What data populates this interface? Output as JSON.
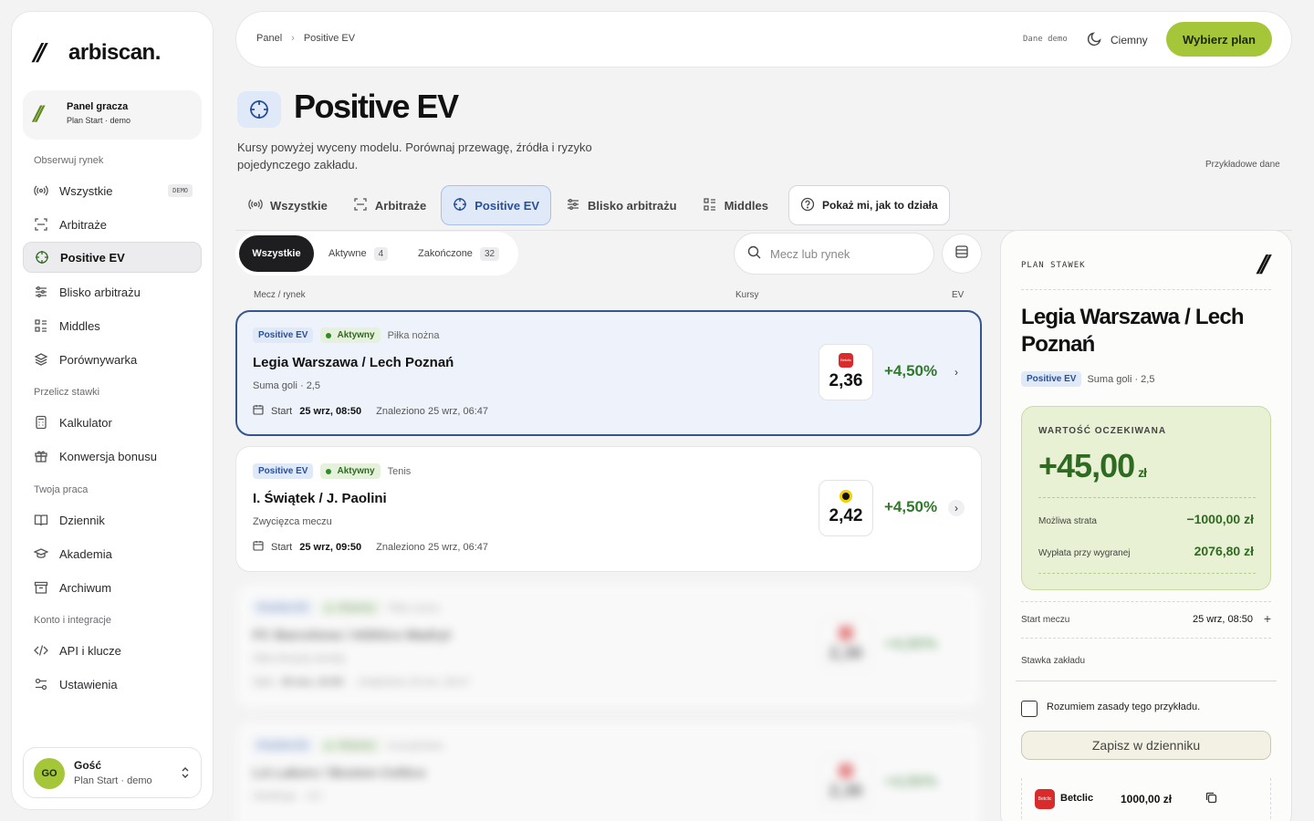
{
  "brand": {
    "name": "arbiscan.",
    "mark": "//"
  },
  "player_card": {
    "title": "Panel gracza",
    "subtitle": "Plan Start · demo"
  },
  "nav": {
    "section_market": "Obserwuj rynek",
    "section_calc": "Przelicz stawki",
    "section_work": "Twoja praca",
    "section_account": "Konto i integracje",
    "items": {
      "all": {
        "label": "Wszystkie",
        "badge": "DEMO"
      },
      "arbs": {
        "label": "Arbitraże"
      },
      "ev": {
        "label": "Positive EV"
      },
      "near": {
        "label": "Blisko arbitrażu"
      },
      "middles": {
        "label": "Middles"
      },
      "compare": {
        "label": "Porównywarka"
      },
      "calculator": {
        "label": "Kalkulator"
      },
      "bonus": {
        "label": "Konwersja bonusu"
      },
      "journal": {
        "label": "Dziennik"
      },
      "academy": {
        "label": "Akademia"
      },
      "archive": {
        "label": "Archiwum"
      },
      "api": {
        "label": "API i klucze"
      },
      "settings": {
        "label": "Ustawienia"
      }
    }
  },
  "user": {
    "initials": "GO",
    "name": "Gość",
    "plan": "Plan Start · demo"
  },
  "topbar": {
    "crumbs": [
      "Panel",
      "Positive EV"
    ],
    "demo_data": "Dane demo",
    "theme_label": "Ciemny",
    "plan_button": "Wybierz plan"
  },
  "page": {
    "title": "Positive EV",
    "description": "Kursy powyżej wyceny modelu. Porównaj przewagę, źródła i ryzyko pojedynczego zakładu.",
    "sample_note": "Przykładowe dane"
  },
  "tabs": {
    "all": "Wszystkie",
    "arbs": "Arbitraże",
    "ev": "Positive EV",
    "near": "Blisko arbitrażu",
    "middles": "Middles",
    "how": "Pokaż mi, jak to działa"
  },
  "filters": {
    "all": "Wszystkie",
    "active": "Aktywne",
    "active_count": "4",
    "finished": "Zakończone",
    "finished_count": "32"
  },
  "search": {
    "placeholder": "Mecz lub rynek"
  },
  "columns": {
    "match": "Mecz / rynek",
    "odds": "Kursy",
    "ev": "EV"
  },
  "cards": [
    {
      "chip_ev": "Positive EV",
      "chip_status": "Aktywny",
      "sport": "Piłka nożna",
      "match": "Legia Warszawa / Lech Poznań",
      "market": "Suma goli · 2,5",
      "start_label": "Start",
      "start": "25 wrz, 08:50",
      "found": "Znaleziono 25 wrz, 06:47",
      "odds": "2,36",
      "ev": "+4,50%"
    },
    {
      "chip_ev": "Positive EV",
      "chip_status": "Aktywny",
      "sport": "Tenis",
      "match": "I. Świątek / J. Paolini",
      "market": "Zwycięzca meczu",
      "start_label": "Start",
      "start": "25 wrz, 09:50",
      "found": "Znaleziono 25 wrz, 06:47",
      "odds": "2,42",
      "ev": "+4,50%"
    },
    {
      "chip_ev": "Positive EV",
      "chip_status": "Aktywny",
      "sport": "Piłka nożna",
      "match": "FC Barcelona / Atlético Madryt",
      "market": "Obie drużyny strzelą",
      "start_label": "Start",
      "start": "25 wrz, 10:50",
      "found": "Znaleziono 25 wrz, 06:47",
      "odds": "2,36",
      "ev": "+4,50%"
    },
    {
      "chip_ev": "Positive EV",
      "chip_status": "Aktywny",
      "sport": "Koszykówka",
      "match": "LA Lakers / Boston Celtics",
      "market": "Handicap · -4,5",
      "start_label": "Start",
      "start": "25 wrz, 11:50",
      "found": "Znaleziono 25 wrz, 06:47",
      "odds": "2,36",
      "ev": "+4,50%"
    }
  ],
  "panel": {
    "label": "PLAN STAWEK",
    "title": "Legia Warszawa / Lech Poznań",
    "chip": "Positive EV",
    "market": "Suma goli · 2,5",
    "ev_label": "WARTOŚĆ OCZEKIWANA",
    "ev_amount": "+45,00",
    "ev_currency": "zł",
    "loss_label": "Możliwa strata",
    "loss_value": "−1000,00 zł",
    "payout_label": "Wypłata przy wygranej",
    "payout_value": "2076,80 zł",
    "start_label": "Start meczu",
    "start_value": "25 wrz, 08:50",
    "stake_label": "Stawka zakładu",
    "ack_label": "Rozumiem zasady tego przykładu.",
    "save_button": "Zapisz w dzienniku",
    "bookmaker": "Betclic",
    "bookmaker_logo": "Betclic",
    "stake_amount": "1000,00 zł"
  },
  "colors": {
    "accent": "#a6c63a",
    "ev_green": "#2f7a2a",
    "selected_blue": "#36558f",
    "chip_blue": "#dfe9f8"
  }
}
